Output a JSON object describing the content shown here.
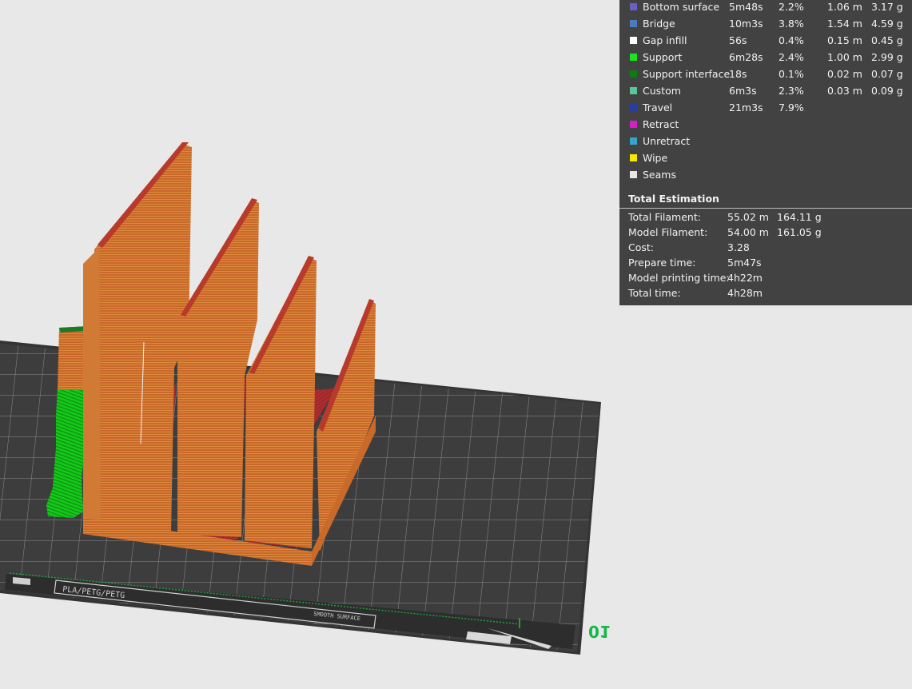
{
  "legend": {
    "rows": [
      {
        "name": "Bottom surface",
        "time": "5m48s",
        "percent": "2.2%",
        "length": "1.06 m",
        "weight": "3.17 g",
        "color": "#6a5fc2"
      },
      {
        "name": "Bridge",
        "time": "10m3s",
        "percent": "3.8%",
        "length": "1.54 m",
        "weight": "4.59 g",
        "color": "#4d7bbf"
      },
      {
        "name": "Gap infill",
        "time": "56s",
        "percent": "0.4%",
        "length": "0.15 m",
        "weight": "0.45 g",
        "color": "#ffffff"
      },
      {
        "name": "Support",
        "time": "6m28s",
        "percent": "2.4%",
        "length": "1.00 m",
        "weight": "2.99 g",
        "color": "#19e51e"
      },
      {
        "name": "Support interface",
        "time": "18s",
        "percent": "0.1%",
        "length": "0.02 m",
        "weight": "0.07 g",
        "color": "#107a15"
      },
      {
        "name": "Custom",
        "time": "6m3s",
        "percent": "2.3%",
        "length": "0.03 m",
        "weight": "0.09 g",
        "color": "#5dc59a"
      },
      {
        "name": "Travel",
        "time": "21m3s",
        "percent": "7.9%",
        "length": "",
        "weight": "",
        "color": "#2b3d9c"
      },
      {
        "name": "Retract",
        "time": "",
        "percent": "",
        "length": "",
        "weight": "",
        "color": "#d41fc4"
      },
      {
        "name": "Unretract",
        "time": "",
        "percent": "",
        "length": "",
        "weight": "",
        "color": "#35a5cf"
      },
      {
        "name": "Wipe",
        "time": "",
        "percent": "",
        "length": "",
        "weight": "",
        "color": "#f2e800"
      },
      {
        "name": "Seams",
        "time": "",
        "percent": "",
        "length": "",
        "weight": "",
        "color": "#e6e6e6"
      }
    ]
  },
  "total": {
    "title": "Total Estimation",
    "rows": [
      {
        "label": "Total Filament:",
        "v1": "55.02 m",
        "v2": "164.11 g"
      },
      {
        "label": "Model Filament:",
        "v1": "54.00 m",
        "v2": "161.05 g"
      },
      {
        "label": "Cost:",
        "v1": "3.28",
        "v2": ""
      },
      {
        "label": "Prepare time:",
        "v1": "5m47s",
        "v2": ""
      },
      {
        "label": "Model printing time:",
        "v1": "4h22m",
        "v2": ""
      },
      {
        "label": "Total time:",
        "v1": "4h28m",
        "v2": ""
      }
    ]
  },
  "bed": {
    "axis_label": "01",
    "plate_text": "PLA/PETG/PETG",
    "plate_text_2": "SMOOTH SURFACE"
  },
  "colors": {
    "background": "#e8e8e8",
    "panel": "#424242",
    "plate": "#3a3a3a",
    "wall_orange": "#d5782f",
    "wall_edge": "#b83a2a",
    "floor_red": "#a52a2a",
    "support_green": "#19e51e"
  }
}
